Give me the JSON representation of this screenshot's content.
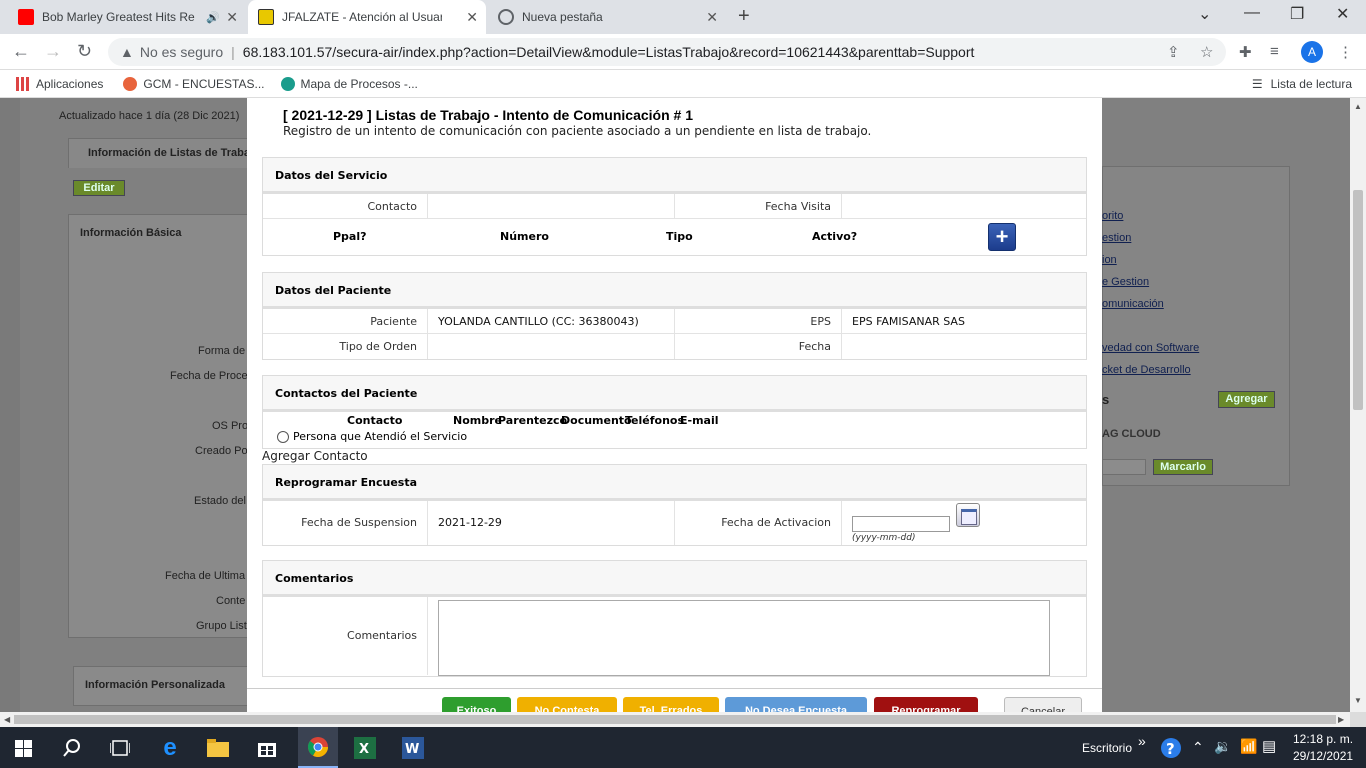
{
  "browser": {
    "tabs": [
      {
        "title": "Bob Marley Greatest Hits Re",
        "active": false
      },
      {
        "title": "JFALZATE - Atención al Usuario -",
        "active": true
      },
      {
        "title": "Nueva pestaña",
        "active": false
      }
    ],
    "url_warning": "No es seguro",
    "url": "68.183.101.57/secura-air/index.php?action=DetailView&module=ListasTrabajo&record=10621443&parenttab=Support",
    "avatar_letter": "A",
    "bookmarks": [
      "Aplicaciones",
      "GCM - ENCUESTAS...",
      "Mapa de Procesos -..."
    ],
    "reading_list": "Lista de lectura"
  },
  "background": {
    "updated": "Actualizado hace 1 día (28 Dic 2021)",
    "tab_label": "Información de Listas de Traba",
    "edit_button": "Editar",
    "basic_info": "Información Básica",
    "field_labels": [
      "Forma de",
      "Fecha de Proce",
      "OS Pro",
      "Creado Po",
      "Estado del",
      "Fecha de Ultima",
      "Conte",
      "Grupo List"
    ],
    "custom_info": "Información Personalizada",
    "links": [
      "orito",
      "estion",
      "ion",
      "e Gestion",
      "omunicación",
      "vedad con Software",
      "cket de Desarrollo"
    ],
    "add_button": "Agregar",
    "tag_cloud": "AG  CLOUD",
    "mark_button": "Marcarlo",
    "s_label": "s"
  },
  "modal": {
    "title": "[ 2021-12-29 ] Listas de Trabajo - Intento de Comunicación # 1",
    "subtitle": "Registro de un intento de comunicación con paciente asociado a un pendiente en lista de trabajo.",
    "servicio": {
      "header": "Datos del Servicio",
      "contacto_label": "Contacto",
      "contacto_value": "",
      "fecha_visita_label": "Fecha Visita",
      "fecha_visita_value": "",
      "cols": [
        "Ppal?",
        "Número",
        "Tipo",
        "Activo?"
      ],
      "add_symbol": "+"
    },
    "paciente": {
      "header": "Datos del Paciente",
      "paciente_label": "Paciente",
      "paciente_value": "YOLANDA CANTILLO (CC: 36380043)",
      "eps_label": "EPS",
      "eps_value": "EPS FAMISANAR SAS",
      "tipo_orden_label": "Tipo de Orden",
      "tipo_orden_value": "",
      "fecha_label": "Fecha",
      "fecha_value": ""
    },
    "contactos": {
      "header": "Contactos del Paciente",
      "cols": [
        "Contacto",
        "Nombre",
        "Parentezco",
        "Documento",
        "Teléfonos",
        "E-mail"
      ],
      "radio_label": "Persona que Atendió el Servicio",
      "add_contact": "Agregar Contacto"
    },
    "reprogramar": {
      "header": "Reprogramar Encuesta",
      "suspension_label": "Fecha de Suspension",
      "suspension_value": "2021-12-29",
      "activacion_label": "Fecha de Activacion",
      "activacion_value": "",
      "date_hint": "(yyyy-mm-dd)"
    },
    "comentarios": {
      "header": "Comentarios",
      "label": "Comentarios",
      "value": ""
    },
    "buttons": [
      {
        "label": "Exitoso",
        "color": "#2e9e2e"
      },
      {
        "label": "No Contesta",
        "color": "#f0b000"
      },
      {
        "label": "Tel. Errados",
        "color": "#f0b000"
      },
      {
        "label": "No Desea Encuesta",
        "color": "#5d9ad8"
      },
      {
        "label": "Reprogramar",
        "color": "#a01010"
      },
      {
        "label": "Cancelar",
        "color": "#eeeeee"
      }
    ]
  },
  "taskbar": {
    "desktop_label": "Escritorio",
    "time": "12:18 p. m.",
    "date": "29/12/2021"
  }
}
